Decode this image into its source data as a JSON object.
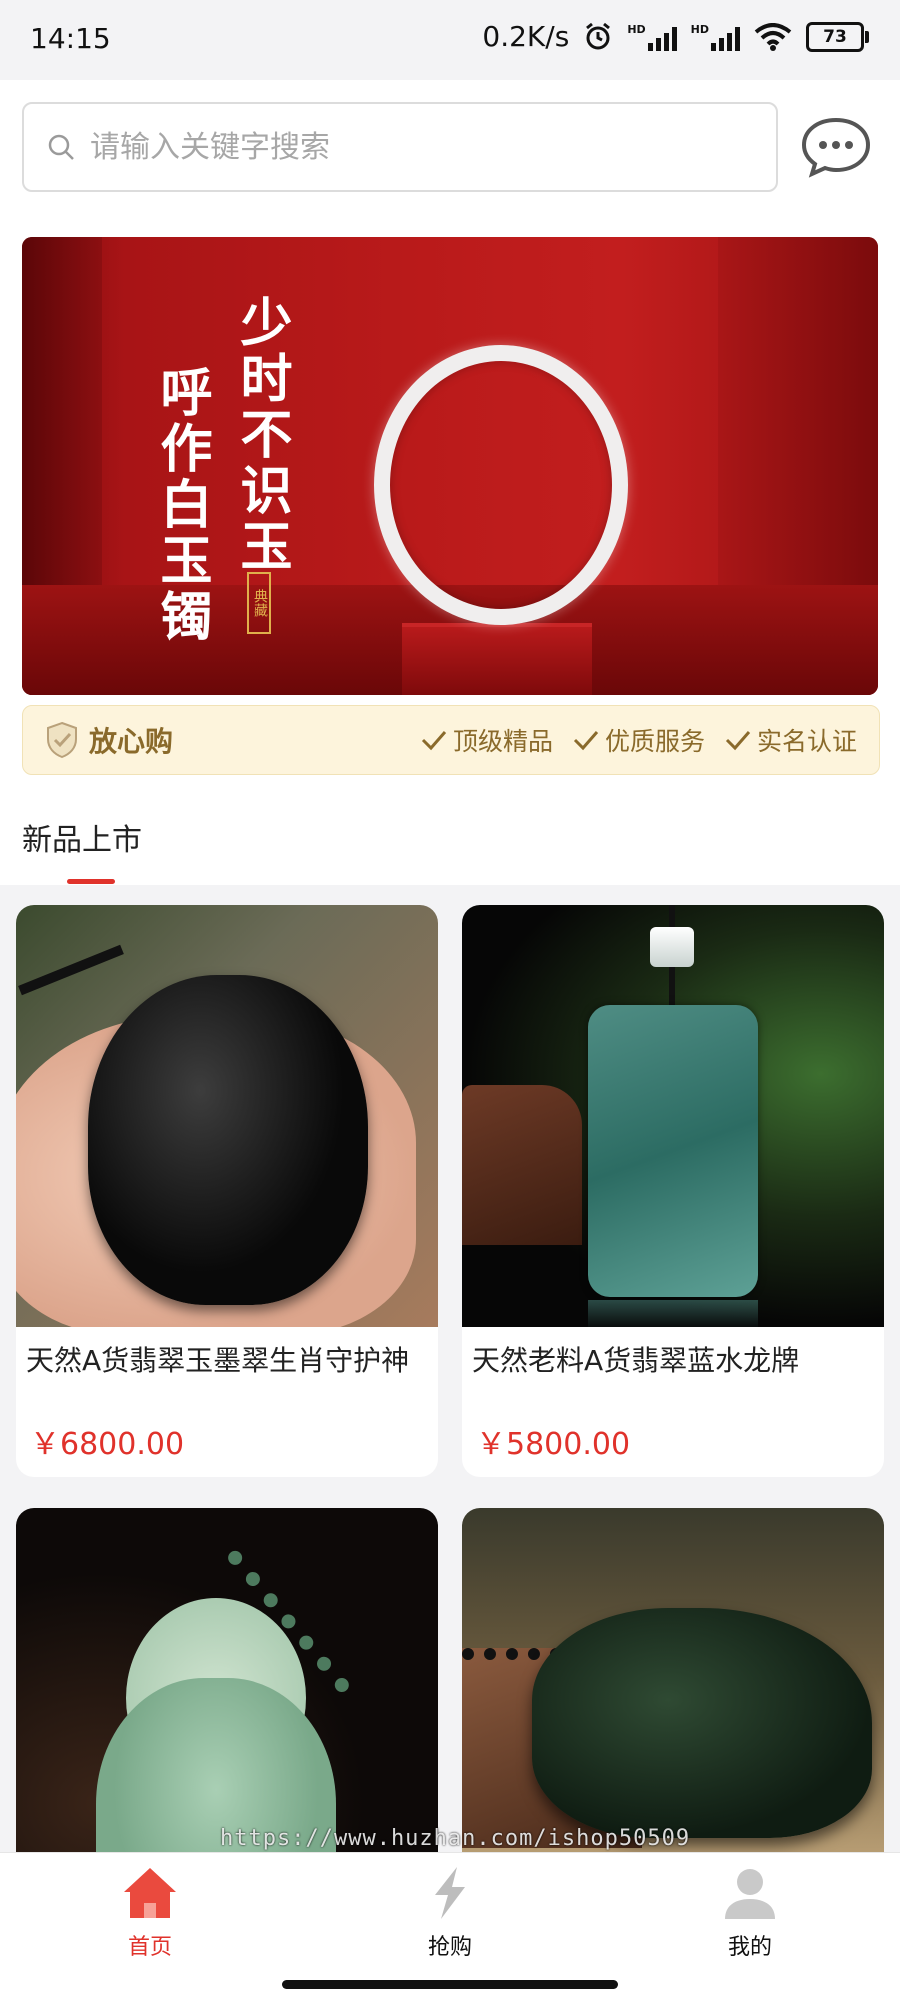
{
  "status_bar": {
    "time": "14:15",
    "net_speed": "0.2K/s",
    "signal_label_1": "HD",
    "signal_label_2": "HD",
    "battery": "73"
  },
  "search": {
    "placeholder": "请输入关键字搜索"
  },
  "banner": {
    "line1": "少时不识玉",
    "line2": "呼作白玉镯",
    "seal": "典藏"
  },
  "assurance": {
    "title": "放心购",
    "items": [
      "顶级精品",
      "优质服务",
      "实名认证"
    ]
  },
  "section": {
    "title": "新品上市"
  },
  "products": [
    {
      "name": "天然A货翡翠玉墨翠生肖守护神",
      "price": "￥6800.00"
    },
    {
      "name": "天然老料A货翡翠蓝水龙牌",
      "price": "￥5800.00"
    },
    {
      "name": "",
      "price": ""
    },
    {
      "name": "",
      "price": ""
    }
  ],
  "watermark": "https://www.huzhan.com/ishop50509",
  "tabbar": {
    "items": [
      {
        "label": "首页",
        "icon": "home-icon",
        "active": true
      },
      {
        "label": "抢购",
        "icon": "lightning-icon",
        "active": false
      },
      {
        "label": "我的",
        "icon": "user-icon",
        "active": false
      }
    ]
  },
  "colors": {
    "accent": "#e0322b",
    "gold_text": "#8a6a2b",
    "assurance_bg": "#fdf4dc"
  }
}
